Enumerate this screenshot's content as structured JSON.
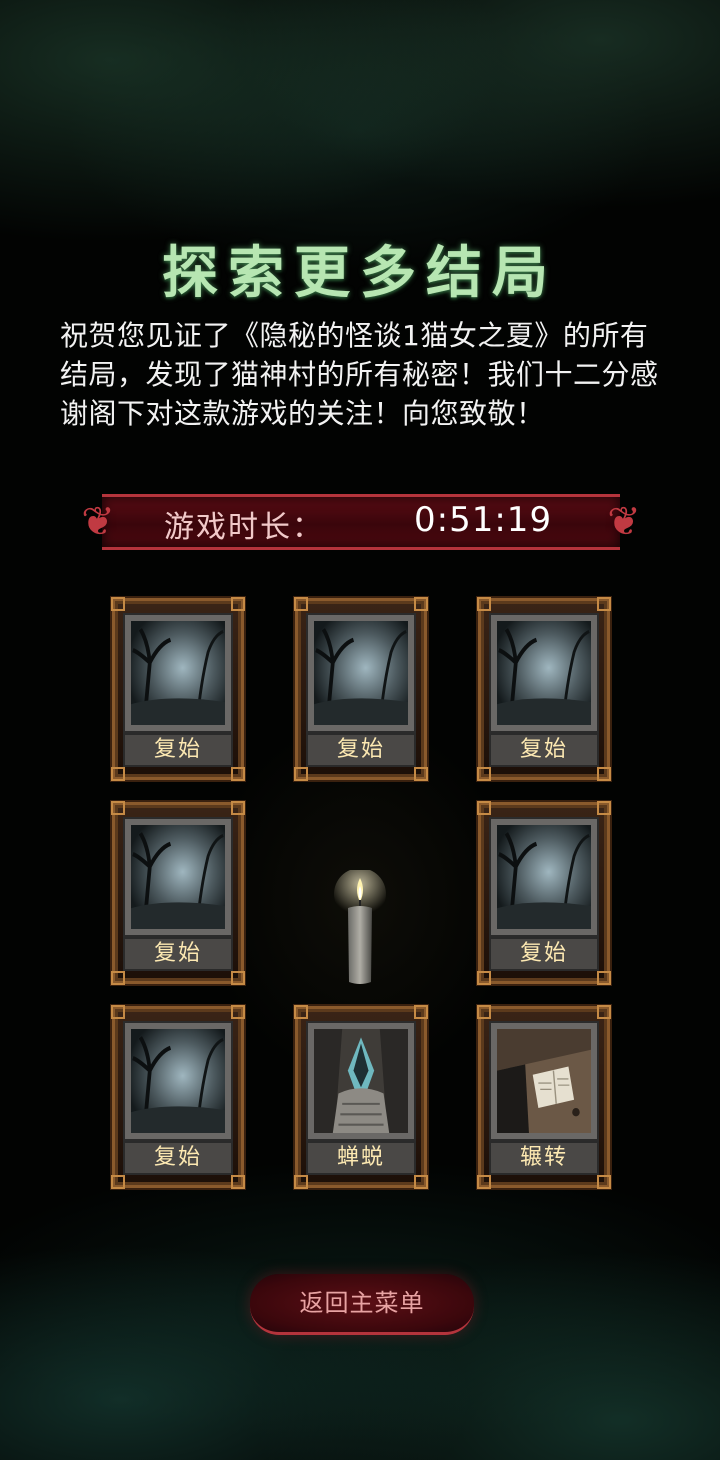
{
  "title": "探索更多结局",
  "description": "祝贺您见证了《隐秘的怪谈1猫女之夏》的所有结局，发现了猫神村的所有秘密！我们十二分感谢阁下对这款游戏的关注！向您致敬！",
  "playtime": {
    "label": "游戏时长：",
    "value": "0:51:19"
  },
  "endings": [
    {
      "label": "复始",
      "art": "forest-scene"
    },
    {
      "label": "复始",
      "art": "forest-scene"
    },
    {
      "label": "复始",
      "art": "forest-scene"
    },
    {
      "label": "复始",
      "art": "forest-scene"
    },
    {
      "label": "复始",
      "art": "forest-scene"
    },
    {
      "label": "复始",
      "art": "forest-scene"
    },
    {
      "label": "蝉蜕",
      "art": "shrine-scene"
    },
    {
      "label": "辗转",
      "art": "desk-scene"
    }
  ],
  "center_icon": "candle-icon",
  "back_button": "返回主菜单",
  "colors": {
    "title": "#b7e6b2",
    "banner": "#5a0c14",
    "frame": "#8a5a2c",
    "caption": "#fde9b2",
    "button_text": "#e8a3a3"
  }
}
